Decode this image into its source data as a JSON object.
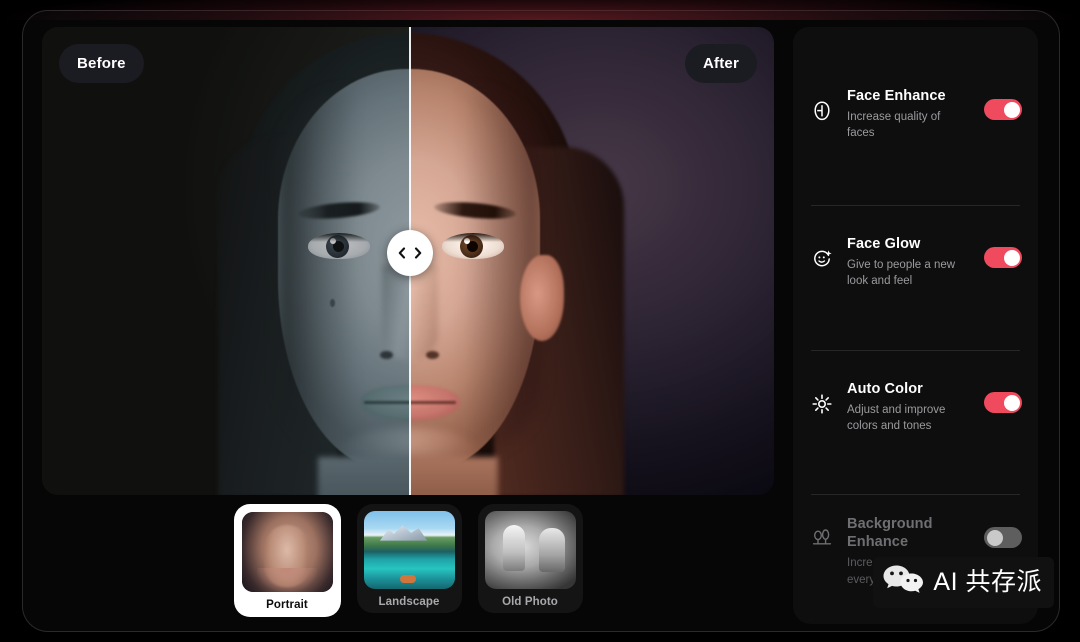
{
  "preview": {
    "before_label": "Before",
    "after_label": "After",
    "slider_handle_icon": "left-right-chevrons-icon"
  },
  "presets": [
    {
      "label": "Portrait",
      "icon": "portrait-thumbnail",
      "selected": true
    },
    {
      "label": "Landscape",
      "icon": "landscape-thumbnail",
      "selected": false
    },
    {
      "label": "Old Photo",
      "icon": "old-photo-thumbnail",
      "selected": false
    }
  ],
  "settings": [
    {
      "title": "Face Enhance",
      "description": "Increase quality of faces",
      "icon": "face-outline-icon",
      "enabled": true,
      "disabled": false
    },
    {
      "title": "Face Glow",
      "description": "Give to people a new look and feel",
      "icon": "smiley-sparkle-icon",
      "enabled": true,
      "disabled": false
    },
    {
      "title": "Auto Color",
      "description": "Adjust and improve colors and tones",
      "icon": "sun-brightness-icon",
      "enabled": true,
      "disabled": false
    },
    {
      "title": "Background Enhance",
      "description": "Increase the quality of every detail",
      "icon": "trees-icon",
      "enabled": false,
      "disabled": true
    }
  ],
  "watermark": {
    "text": "AI 共存派",
    "icon": "wechat-logo-icon"
  },
  "colors": {
    "accent": "#ef4a5e",
    "toggle_off": "#5e5e5e",
    "panel_bg": "#0e0e0e",
    "app_bg": "#000000",
    "divider": "#272727",
    "text_primary": "#ffffff",
    "text_secondary": "#9b9b9f",
    "text_disabled": "#6f6f73"
  }
}
